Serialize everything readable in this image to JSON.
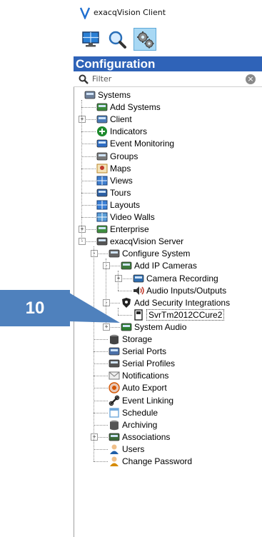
{
  "app": {
    "title": "exacqVision Client",
    "logo_icon": "exacq-v-logo-icon"
  },
  "toolbar": {
    "buttons": [
      {
        "name": "live-view-button",
        "icon": "monitor-icon",
        "active": false
      },
      {
        "name": "search-button",
        "icon": "magnifier-icon",
        "active": false
      },
      {
        "name": "configuration-button",
        "icon": "gears-icon",
        "active": true
      }
    ]
  },
  "config": {
    "header": "Configuration"
  },
  "filter": {
    "placeholder": "Filter",
    "clear_icon": "clear-icon"
  },
  "tree": {
    "items": [
      {
        "label": "Systems",
        "icon": "systems-icon",
        "depth": 0,
        "expander": null,
        "row": 0
      },
      {
        "label": "Add Systems",
        "icon": "add-systems-icon",
        "depth": 1,
        "expander": null,
        "row": 1
      },
      {
        "label": "Client",
        "icon": "client-icon",
        "depth": 1,
        "expander": "+",
        "row": 2
      },
      {
        "label": "Indicators",
        "icon": "indicators-icon",
        "depth": 1,
        "expander": null,
        "row": 3
      },
      {
        "label": "Event Monitoring",
        "icon": "event-monitoring-icon",
        "depth": 1,
        "expander": null,
        "row": 4
      },
      {
        "label": "Groups",
        "icon": "groups-icon",
        "depth": 1,
        "expander": null,
        "row": 5
      },
      {
        "label": "Maps",
        "icon": "maps-icon",
        "depth": 1,
        "expander": null,
        "row": 6
      },
      {
        "label": "Views",
        "icon": "views-icon",
        "depth": 1,
        "expander": null,
        "row": 7
      },
      {
        "label": "Tours",
        "icon": "tours-icon",
        "depth": 1,
        "expander": null,
        "row": 8
      },
      {
        "label": "Layouts",
        "icon": "layouts-icon",
        "depth": 1,
        "expander": null,
        "row": 9
      },
      {
        "label": "Video Walls",
        "icon": "video-walls-icon",
        "depth": 1,
        "expander": null,
        "row": 10
      },
      {
        "label": "Enterprise",
        "icon": "enterprise-icon",
        "depth": 1,
        "expander": "+",
        "row": 11
      },
      {
        "label": "exacqVision Server",
        "icon": "server-icon",
        "depth": 1,
        "expander": "-",
        "row": 12
      },
      {
        "label": "Configure System",
        "icon": "configure-system-icon",
        "depth": 2,
        "expander": "-",
        "row": 13
      },
      {
        "label": "Add IP Cameras",
        "icon": "add-ip-cameras-icon",
        "depth": 3,
        "expander": "-",
        "row": 14
      },
      {
        "label": "Camera Recording",
        "icon": "camera-recording-icon",
        "depth": 4,
        "expander": "+",
        "row": 15
      },
      {
        "label": "Audio Inputs/Outputs",
        "icon": "audio-icon",
        "depth": 4,
        "expander": null,
        "row": 16
      },
      {
        "label": "Add Security Integrations",
        "icon": "security-integrations-icon",
        "depth": 3,
        "expander": "-",
        "row": 17
      },
      {
        "label": "SvrTm2012CCure2",
        "icon": "integration-device-icon",
        "depth": 4,
        "expander": null,
        "row": 18,
        "selected": true
      },
      {
        "label": "System Audio",
        "icon": "system-audio-icon",
        "depth": 3,
        "expander": "+",
        "row": 19
      },
      {
        "label": "Storage",
        "icon": "storage-icon",
        "depth": 2,
        "expander": null,
        "row": 20
      },
      {
        "label": "Serial Ports",
        "icon": "serial-ports-icon",
        "depth": 2,
        "expander": null,
        "row": 21
      },
      {
        "label": "Serial Profiles",
        "icon": "serial-profiles-icon",
        "depth": 2,
        "expander": null,
        "row": 22
      },
      {
        "label": "Notifications",
        "icon": "notifications-icon",
        "depth": 2,
        "expander": null,
        "row": 23
      },
      {
        "label": "Auto Export",
        "icon": "auto-export-icon",
        "depth": 2,
        "expander": null,
        "row": 24
      },
      {
        "label": "Event Linking",
        "icon": "event-linking-icon",
        "depth": 2,
        "expander": null,
        "row": 25
      },
      {
        "label": "Schedule",
        "icon": "schedule-icon",
        "depth": 2,
        "expander": null,
        "row": 26
      },
      {
        "label": "Archiving",
        "icon": "archiving-icon",
        "depth": 2,
        "expander": null,
        "row": 27
      },
      {
        "label": "Associations",
        "icon": "associations-icon",
        "depth": 2,
        "expander": "+",
        "row": 28
      },
      {
        "label": "Users",
        "icon": "users-icon",
        "depth": 2,
        "expander": null,
        "row": 29
      },
      {
        "label": "Change Password",
        "icon": "change-password-icon",
        "depth": 2,
        "expander": null,
        "row": 30
      }
    ]
  },
  "callout": {
    "label": "10",
    "color": "#4f81bd"
  }
}
